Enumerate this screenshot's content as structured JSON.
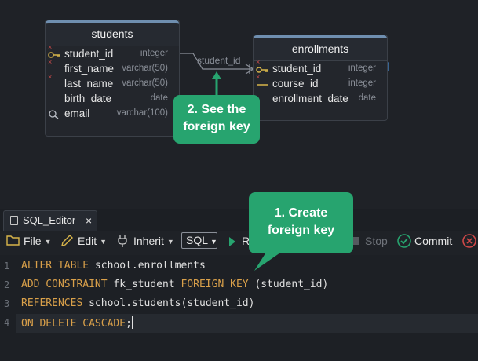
{
  "diagram": {
    "students": {
      "title": "students",
      "columns": [
        {
          "name": "student_id",
          "type": "integer"
        },
        {
          "name": "first_name",
          "type": "varchar(50)"
        },
        {
          "name": "last_name",
          "type": "varchar(50)"
        },
        {
          "name": "birth_date",
          "type": "date"
        },
        {
          "name": "email",
          "type": "varchar(100)"
        }
      ]
    },
    "enrollments": {
      "title": "enrollments",
      "columns": [
        {
          "name": "student_id",
          "type": "integer"
        },
        {
          "name": "course_id",
          "type": "integer"
        },
        {
          "name": "enrollment_date",
          "type": "date"
        }
      ]
    },
    "relation_label": "student_id",
    "callout_fk": {
      "line1": "2. See the",
      "line2": "foreign key"
    }
  },
  "callout_create": {
    "line1": "1. Create",
    "line2": "foreign key"
  },
  "editor": {
    "tab_label": "SQL_Editor",
    "tab_close": "×",
    "toolbar": {
      "file": "File",
      "edit": "Edit",
      "inherit": "Inherit",
      "sql": "SQL",
      "run_partial": "R",
      "stop": "Stop",
      "commit": "Commit"
    },
    "line_numbers": [
      "1",
      "2",
      "3",
      "4"
    ],
    "lines": [
      {
        "kw1": "ALTER TABLE",
        "rest1": " school.enrollments"
      },
      {
        "kw1": "ADD CONSTRAINT",
        "rest1": " fk_student ",
        "kw2": "FOREIGN KEY",
        "rest2": " (student_id)"
      },
      {
        "kw1": "REFERENCES",
        "rest1": " school.students(student_id)"
      },
      {
        "kw1": "ON DELETE CASCADE",
        "rest1": ";"
      }
    ]
  },
  "colors": {
    "accent_green": "#27a46f",
    "keyword": "#d9a04a",
    "key_icon": "#d8b54a"
  }
}
